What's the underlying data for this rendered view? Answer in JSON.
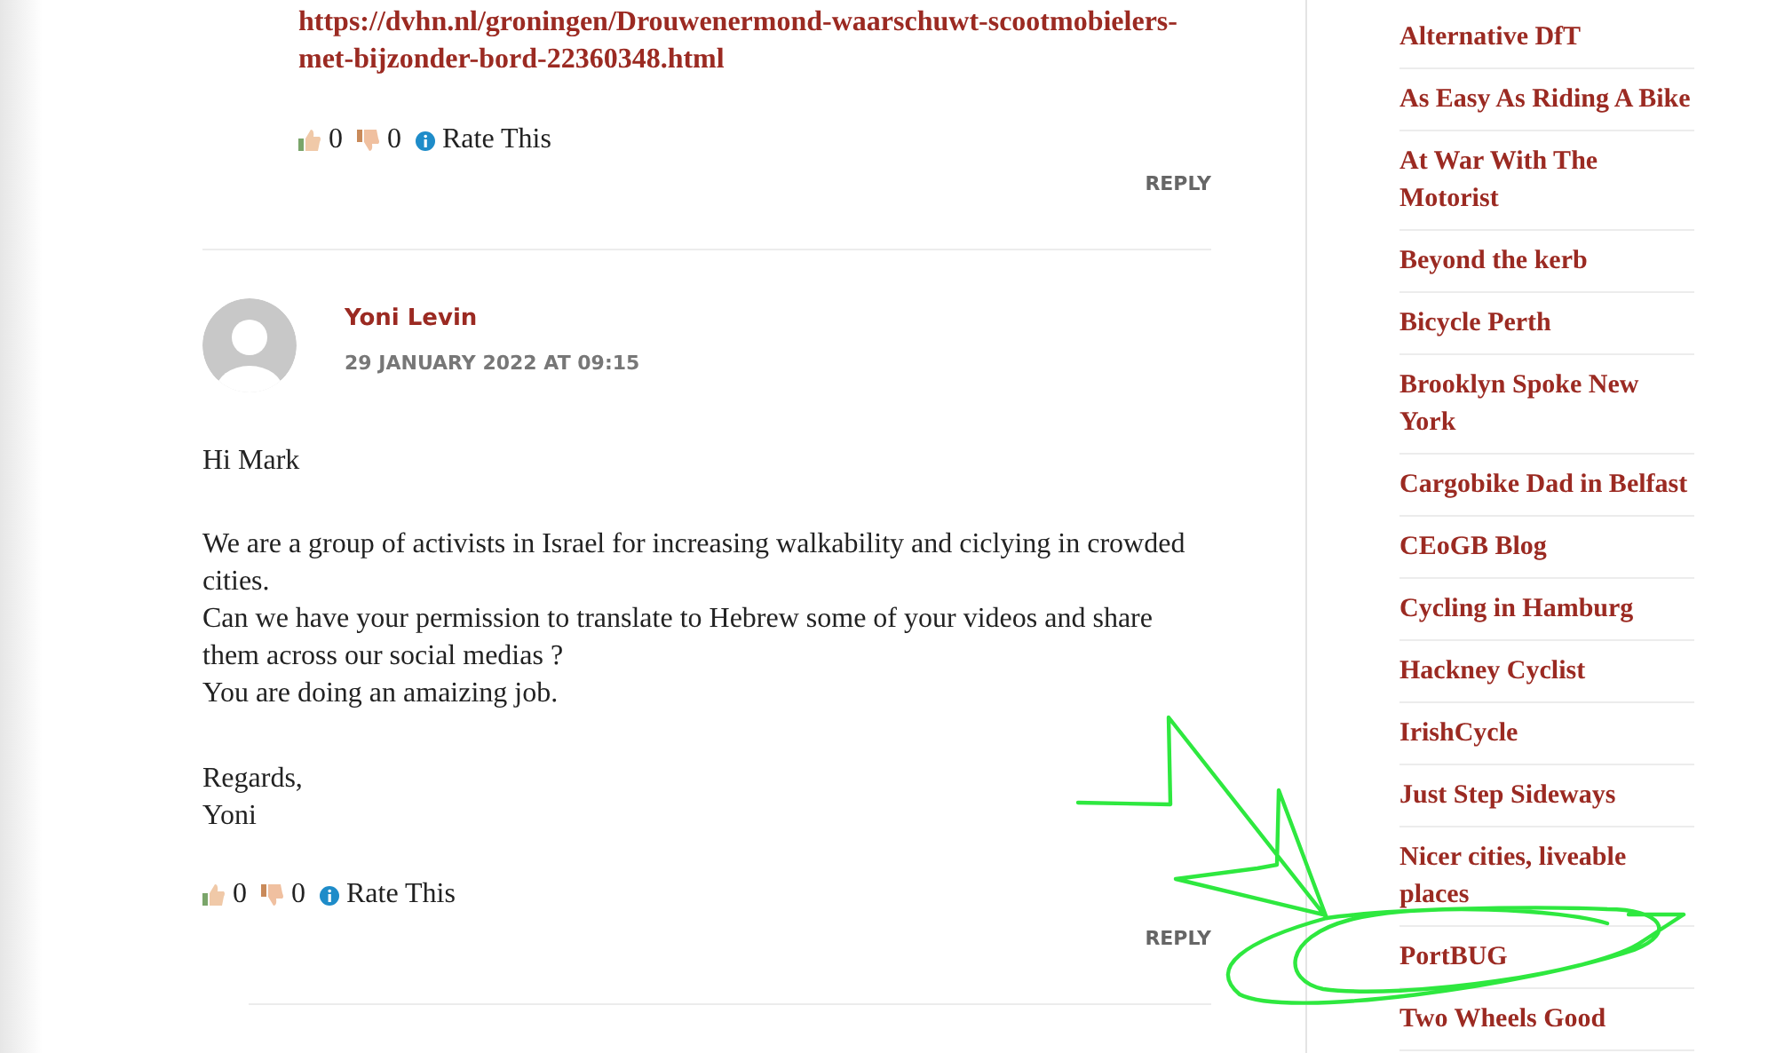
{
  "comments": [
    {
      "link": "https://dvhn.nl/groningen/Drouwenermond-waarschuwt-scootmobielers-met-bijzonder-bord-22360348.html",
      "likes": "0",
      "dislikes": "0",
      "rate": "Rate This",
      "reply": "REPLY"
    },
    {
      "author": "Yoni Levin",
      "date": "29 JANUARY 2022 AT 09:15",
      "paragraphs": [
        [
          "Hi Mark"
        ],
        [
          "We are a group of activists in Israel for increasing walkability and ciclying in crowded",
          "cities.",
          "Can we have your permission to translate to Hebrew some of your videos and share",
          "them across our social medias ?",
          "You are doing an amaizing job."
        ],
        [
          "Regards,",
          "Yoni"
        ]
      ],
      "likes": "0",
      "dislikes": "0",
      "rate": "Rate This",
      "reply": "REPLY"
    }
  ],
  "sidebar": {
    "links": [
      "Alternative DfT",
      "As Easy As Riding A Bike",
      "At War With The Motorist",
      "Beyond the kerb",
      "Bicycle Perth",
      "Brooklyn Spoke New York",
      "Cargobike Dad in Belfast",
      "CEoGB Blog",
      "Cycling in Hamburg",
      "Hackney Cyclist",
      "IrishCycle",
      "Just Step Sideways",
      "Nicer cities, liveable places",
      "PortBUG",
      "Two Wheels Good"
    ]
  }
}
